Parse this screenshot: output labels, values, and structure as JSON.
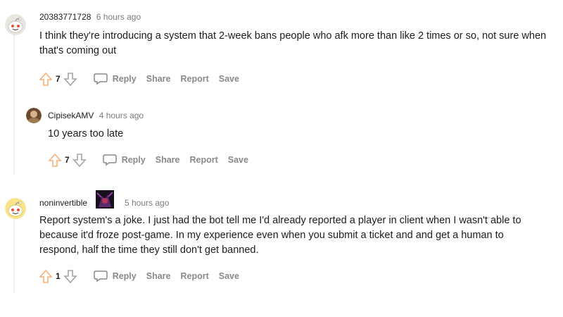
{
  "comments": [
    {
      "author": "20383771728",
      "time": "6 hours ago",
      "body": "I think they're introducing a system that 2-week bans people who afk more than like 2 times or so, not sure when that's coming out",
      "score": "7",
      "reply_label": "Reply",
      "share_label": "Share",
      "report_label": "Report",
      "save_label": "Save",
      "avatar_icon": "snoo-avatar-icon"
    },
    {
      "author": "CipisekAMV",
      "time": "4 hours ago",
      "body": "10 years too late",
      "score": "7",
      "reply_label": "Reply",
      "share_label": "Share",
      "report_label": "Report",
      "save_label": "Save",
      "avatar_icon": "user-avatar-icon"
    },
    {
      "author": "noninvertible",
      "time": "5 hours ago",
      "body": "Report system's a joke. I just had the bot tell me I'd already reported a player in client when I wasn't able to because it'd froze post-game. In my experience even when you submit a ticket and and get a human to respond, half the time they still don't get banned.",
      "score": "1",
      "reply_label": "Reply",
      "share_label": "Share",
      "report_label": "Report",
      "save_label": "Save",
      "avatar_icon": "snoo-avatar-icon",
      "flair_icon": "user-flair-icon"
    }
  ],
  "colors": {
    "upvote": "#f5b27a",
    "downvote": "#a5a4a4",
    "action": "#878a8c",
    "thread_line": "#edeff1"
  }
}
